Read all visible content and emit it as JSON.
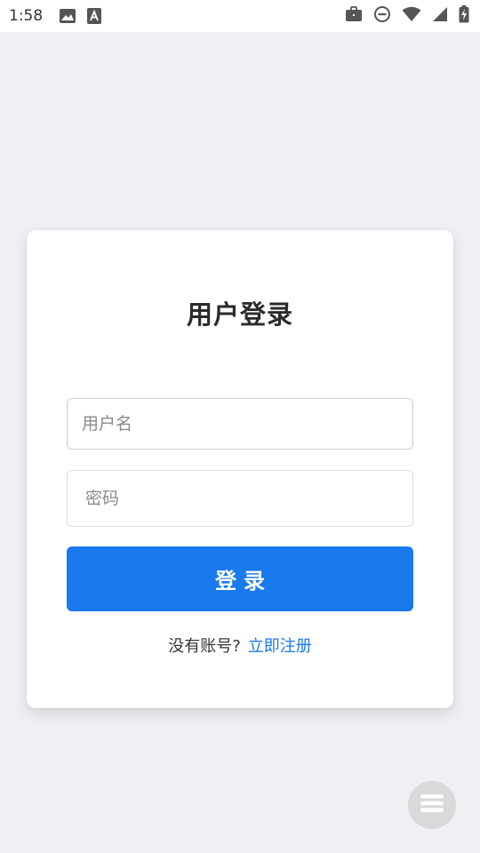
{
  "status_bar": {
    "time": "1:58",
    "icons_left": [
      "image-icon",
      "text-a-icon"
    ],
    "icons_right": [
      "briefcase-icon",
      "do-not-disturb-icon",
      "wifi-icon",
      "signal-icon",
      "battery-charging-icon"
    ]
  },
  "login": {
    "title": "用户登录",
    "username_placeholder": "用户名",
    "password_placeholder": "密码",
    "submit_label": "登录",
    "no_account_text": "没有账号?",
    "register_link": "立即注册"
  },
  "fab": {
    "icon": "menu-icon"
  },
  "colors": {
    "background": "#eef0f4",
    "primary": "#1a79ec",
    "card": "#ffffff"
  }
}
